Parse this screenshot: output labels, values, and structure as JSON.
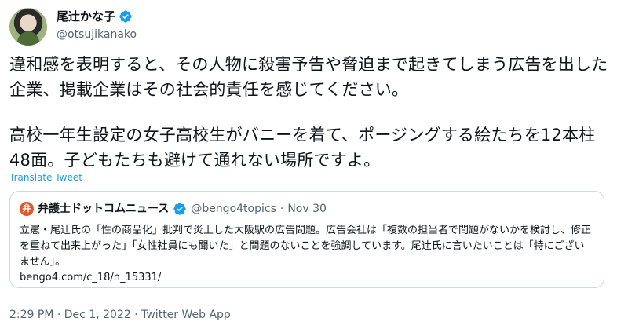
{
  "author": {
    "name": "尾辻かな子",
    "handle": "@otsujikanako"
  },
  "tweet": {
    "paragraph1": "違和感を表明すると、その人物に殺害予告や脅迫まで起きてしまう広告を出した企業、掲載企業はその社会的責任を感じてください。",
    "paragraph2": "高校一年生設定の女子高校生がバニーを着て、ポージングする絵たちを12本柱48面。子どもたちも避けて通れない場所ですよ。",
    "translate_label": "Translate Tweet"
  },
  "quoted_tweet": {
    "logo_letter": "弁",
    "name": "弁護士ドットコムニュース",
    "handle": "@bengo4topics",
    "separator": "·",
    "date": "Nov 30",
    "text": "立憲・尾辻氏の「性の商品化」批判で炎上した大阪駅の広告問題。広告会社は「複数の担当者で問題がないかを検討し、修正を重ねて出来上がった」「女性社員にも聞いた」と問題のないことを強調しています。尾辻氏に言いたいことは「特にございません」。",
    "link": "bengo4.com/c_18/n_15331/"
  },
  "footer": {
    "time": "2:29 PM",
    "separator1": " · ",
    "date": "Dec 1, 2022",
    "separator2": " · ",
    "source": "Twitter Web App"
  },
  "colors": {
    "link": "#1d9bf0",
    "secondary_text": "#536471",
    "border": "#cfd9de",
    "verified": "#1d9bf0"
  },
  "icons": {
    "verified": "verified-badge-icon"
  }
}
